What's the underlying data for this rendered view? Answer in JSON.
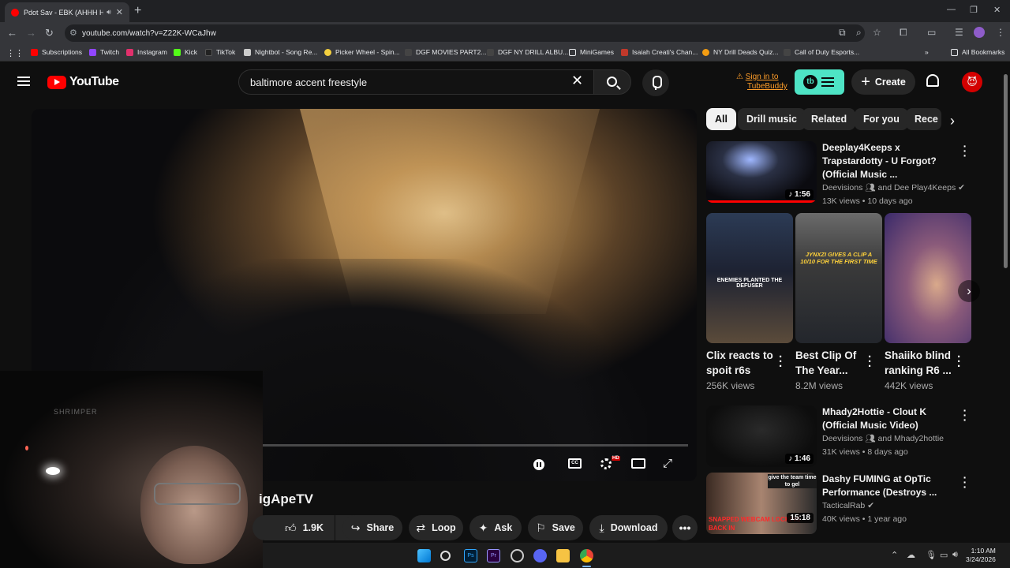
{
  "browser": {
    "tab_title": "Pdot Sav - EBK (AHHH HA)",
    "url": "youtube.com/watch?v=Z22K-WCaJhw",
    "bookmarks": [
      {
        "label": "Subscriptions",
        "color": "#ff0000"
      },
      {
        "label": "Twitch",
        "color": "#9146ff"
      },
      {
        "label": "Instagram",
        "color": "#e1306c"
      },
      {
        "label": "Kick",
        "color": "#53fc18"
      },
      {
        "label": "TikTok",
        "color": "#111111"
      },
      {
        "label": "Nightbot - Song Re...",
        "color": "#cccccc"
      },
      {
        "label": "Picker Wheel - Spin...",
        "color": "#f4d03f"
      },
      {
        "label": "DGF MOVIES PART2...",
        "color": "#333333"
      },
      {
        "label": "DGF NY DRILL ALBU...",
        "color": "#333333"
      },
      {
        "label": "MiniGames",
        "color": "#e8eaed"
      },
      {
        "label": "Isaiah Creati's Chan...",
        "color": "#c0392b"
      },
      {
        "label": "NY Drill Deads Quiz...",
        "color": "#f39c12"
      },
      {
        "label": "Call of Duty Esports...",
        "color": "#444444"
      }
    ],
    "all_bookmarks": "All Bookmarks"
  },
  "youtube": {
    "logo": "YouTube",
    "search_query": "baltimore accent freestyle",
    "tubebuddy_line1": "Sign in to",
    "tubebuddy_line2": "TubeBuddy",
    "tubebuddy_badge": "tb",
    "create_label": "Create",
    "video_title": "igApeTV",
    "likes": "1.9K",
    "actions": {
      "share": "Share",
      "loop": "Loop",
      "ask": "Ask",
      "save": "Save",
      "download": "Download"
    },
    "player_controls": {
      "cc": "CC",
      "hd": "HD"
    },
    "webcam_sign": "SHRIMPER"
  },
  "sidebar": {
    "chips": [
      "All",
      "Drill music",
      "Related",
      "For you",
      "Rece"
    ],
    "videos": [
      {
        "title": "Deeplay4Keeps x Trapstardotty - U Forgot? (Official Music ...",
        "channel": "Deevisions",
        "channel_extra": "and Dee Play4Keeps",
        "meta": "13K views • 10 days ago",
        "duration": "1:56"
      },
      {
        "title": "Mhady2Hottie - Clout K (Official Music Video)",
        "channel": "Deevisions",
        "channel_extra": "and Mhady2hottie",
        "meta": "31K views • 8 days ago",
        "duration": "1:46"
      },
      {
        "title": "Dashy FUMING at OpTic Performance (Destroys ...",
        "channel": "TacticalRab",
        "channel_extra": "",
        "meta": "40K views • 1 year ago",
        "duration": "15:18"
      }
    ],
    "shorts": [
      {
        "title": "Clix reacts to spoit r6s",
        "views": "256K views",
        "overlay": "ENEMIES PLANTED THE DEFUSER"
      },
      {
        "title": "Best Clip Of The Year...",
        "views": "8.2M views",
        "overlay": "JYNXZI GIVES A CLIP A 10/10 FOR THE FIRST TIME"
      },
      {
        "title": "Shaiiko blind ranking R6 ...",
        "views": "442K views",
        "overlay": ""
      }
    ],
    "dashy_overlay_top": "give the team time to gel",
    "dashy_overlay_bottom": "SNAPPED WEBCAM LOCKING BACK IN"
  },
  "taskbar": {
    "time": "1:10 AM",
    "date": "3/24/2026"
  }
}
